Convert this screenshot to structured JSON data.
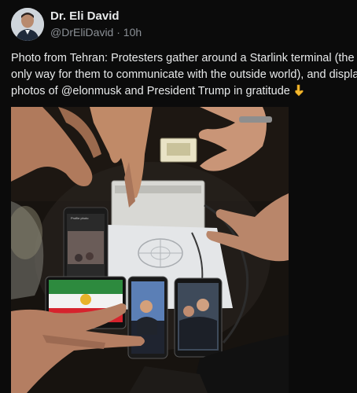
{
  "author": {
    "name": "Dr. Eli David",
    "handle": "@DrEliDavid",
    "separator": "·",
    "time": "10h"
  },
  "post": {
    "line1": "Photo from Tehran: Protesters gather around a Starlink terminal (the",
    "line2": "only way for them to communicate with the outside world), and display",
    "line3_pre": "photos of ",
    "line3_mention": "@elonmusk",
    "line3_post": " and President Trump in gratitude",
    "emoji": "pointing-down-hand"
  },
  "photo": {
    "phone_header_text": "Profile photo"
  },
  "colors": {
    "background": "#0b0b0b",
    "text": "#e7e9ea",
    "muted": "#8b9096"
  }
}
